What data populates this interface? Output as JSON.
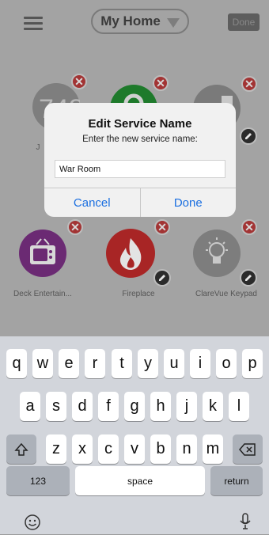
{
  "header": {
    "title": "My Home",
    "done_label": "Done"
  },
  "tiles": [
    {
      "name": "tile-clock",
      "label": "J",
      "icon": "clock-icon"
    },
    {
      "name": "tile-lock",
      "label": "",
      "icon": "lock-icon"
    },
    {
      "name": "tile-door",
      "label": "ck",
      "icon": "door-icon"
    },
    {
      "name": "tile-deck",
      "label": "Deck Entertain...",
      "icon": "tv-icon"
    },
    {
      "name": "tile-fireplace",
      "label": "Fireplace",
      "icon": "flame-icon"
    },
    {
      "name": "tile-keypad",
      "label": "ClareVue Keypad",
      "icon": "lightbulb-icon"
    }
  ],
  "tile_colors": {
    "clock": "#7e7e7e",
    "lock": "#1e7a2b",
    "door": "#7a7a7a",
    "deck": "#6b2a73",
    "fireplace": "#a82525",
    "keypad": "#7d7d7d"
  },
  "dialog": {
    "title": "Edit Service Name",
    "message": "Enter the new service name:",
    "input_value": "War Room",
    "cancel_label": "Cancel",
    "done_label": "Done"
  },
  "keyboard": {
    "row1": [
      "q",
      "w",
      "e",
      "r",
      "t",
      "y",
      "u",
      "i",
      "o",
      "p"
    ],
    "row2": [
      "a",
      "s",
      "d",
      "f",
      "g",
      "h",
      "j",
      "k",
      "l"
    ],
    "row3": [
      "z",
      "x",
      "c",
      "v",
      "b",
      "n",
      "m"
    ],
    "numbers_label": "123",
    "space_label": "space",
    "return_label": "return"
  },
  "accent_color": "#1b6fe0"
}
